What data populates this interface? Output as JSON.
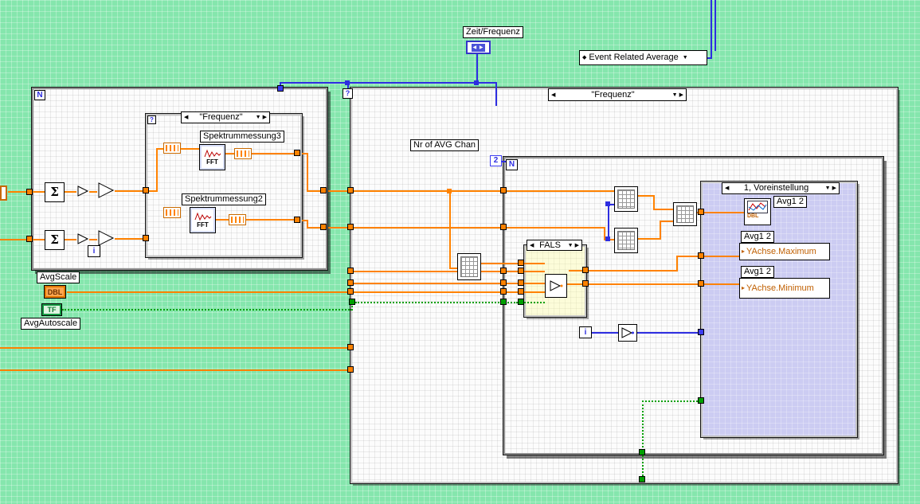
{
  "icons": {
    "left_arrow": "◀",
    "right_arrow": "▶",
    "caret_down": "▼",
    "diamond": "◆",
    "enum_arrows": "◀ ▶",
    "sigma": "Σ",
    "question": "?",
    "pnode_arrow": "▸"
  },
  "top": {
    "zeit_frequenz": "Zeit/Frequenz",
    "event_ring": "Event Related Average"
  },
  "left": {
    "loop_n": "N",
    "loop_i": "i",
    "case_name": "\"Frequenz\"",
    "spektrum3": "Spektrummessung3",
    "spektrum2": "Spektrummessung2",
    "fft": "FFT",
    "avgscale": "AvgScale",
    "dbl": "DBL",
    "tf": "TF",
    "avgautoscale": "AvgAutoscale"
  },
  "right": {
    "case_name": "\"Frequenz\"",
    "nr_avg_chan": "Nr of AVG Chan",
    "count": "2",
    "loop_n": "N",
    "loop_i": "i",
    "fals": "FALS",
    "voreinstellung": "1, Voreinstellung",
    "avg12": "Avg1 2",
    "yachse_max": "YAchse.Maximum",
    "yachse_min": "YAchse.Minimum",
    "dbl": "DBL"
  }
}
